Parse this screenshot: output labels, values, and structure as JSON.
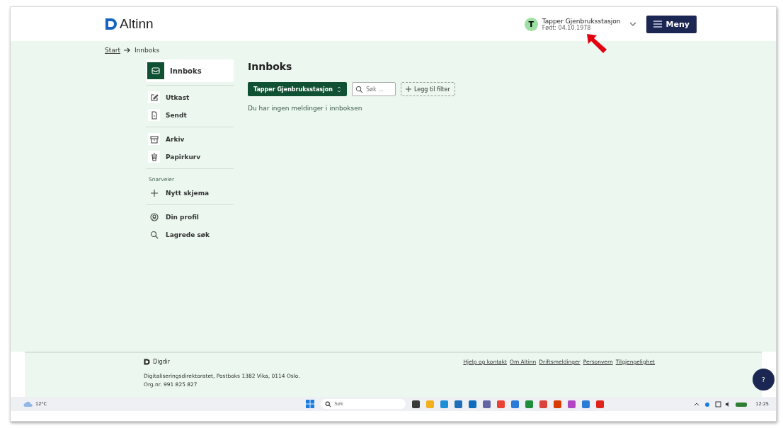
{
  "header": {
    "logo": "Altinn",
    "user": {
      "initial": "T",
      "name": "Tapper Gjenbruksstasjon",
      "born": "Født: 04.10.1978"
    },
    "menu_button": "Meny"
  },
  "breadcrumb": {
    "link": "Start",
    "current": "Innboks"
  },
  "sidebar": {
    "groups": [
      {
        "items": [
          {
            "label": "Innboks",
            "selected": true
          }
        ]
      },
      {
        "items": [
          {
            "label": "Utkast",
            "selected": false
          },
          {
            "label": "Sendt",
            "selected": false
          }
        ]
      },
      {
        "items": [
          {
            "label": "Arkiv",
            "selected": false
          },
          {
            "label": "Papirkurv",
            "selected": false
          }
        ]
      },
      {
        "heading": "Snarveier",
        "items": [
          {
            "label": "Nytt skjema",
            "selected": false
          }
        ]
      },
      {
        "items": [
          {
            "label": "Din profil",
            "selected": false
          },
          {
            "label": "Lagrede søk",
            "selected": false
          }
        ]
      }
    ]
  },
  "main": {
    "title": "Innboks",
    "account_select": "Tapper Gjenbruksstasjon",
    "search": {
      "placeholder": "Søk ..."
    },
    "filter_button": "Legg til filter",
    "empty_message": "Du har ingen meldinger i innboksen"
  },
  "footer": {
    "brand": "Digdir",
    "address": "Digitaliseringsdirektoratet, Postboks 1382 Vika, 0114 Oslo.",
    "org": "Org.nr. 991 825 827",
    "links": [
      "Hjelp og kontakt",
      "Om Altinn",
      "Driftsmeldinger",
      "Personvern",
      "Tilgjengelighet"
    ],
    "help_button": "?"
  },
  "taskbar": {
    "weather": "12°C",
    "search": {
      "placeholder": "Søk"
    },
    "time": "12:25"
  }
}
